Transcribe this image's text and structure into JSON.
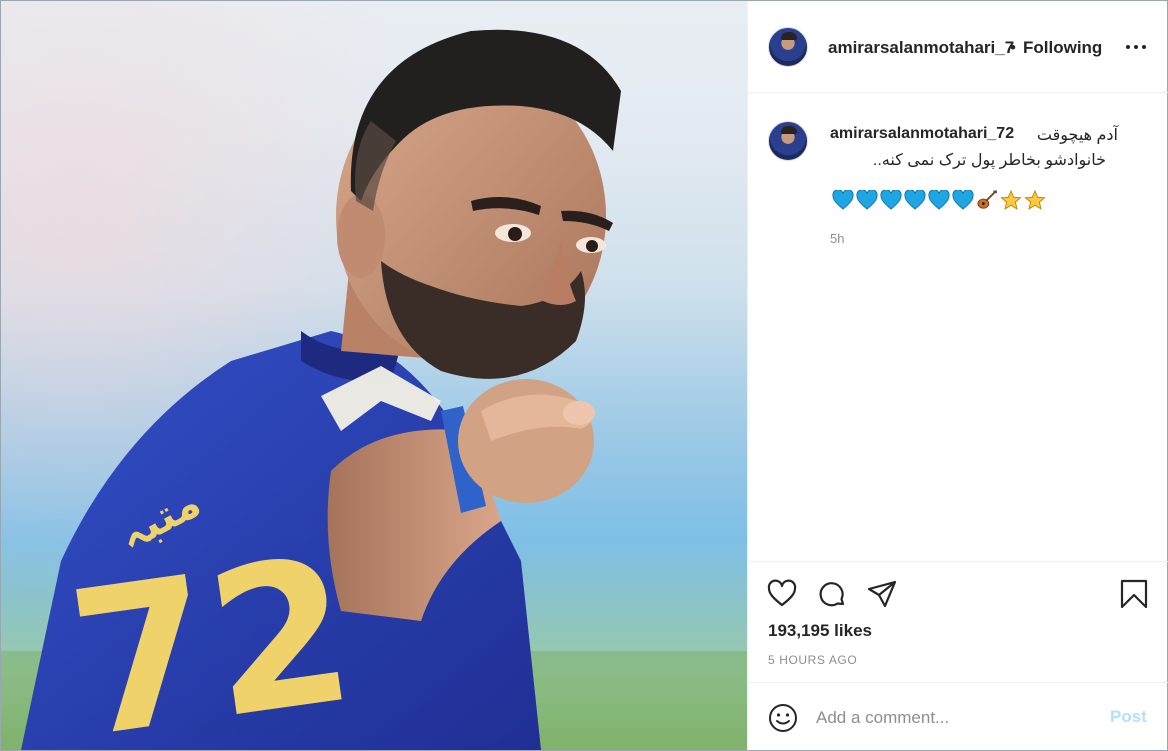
{
  "post": {
    "username": "amirarsalanmotahari_7",
    "separator": "•",
    "follow_status": "Following",
    "image_alt": "player-photo"
  },
  "caption": {
    "username": "amirarsalanmotahari_72",
    "text_line1": "آدم هیچوقت",
    "text_line2": "خانوادشو بخاطر پول ترک نمی کنه..",
    "emojis": [
      "blue-heart",
      "blue-heart",
      "blue-heart",
      "blue-heart",
      "blue-heart",
      "blue-heart",
      "guitar",
      "star",
      "star"
    ],
    "time": "5h"
  },
  "actions": {
    "likes": "193,195 likes",
    "posted": "5 HOURS AGO"
  },
  "comment_box": {
    "placeholder": "Add a comment...",
    "post_label": "Post"
  },
  "colors": {
    "jersey": "#2b3fb5",
    "number": "#f0d26a",
    "text": "#262626",
    "muted": "#8e8e8e",
    "post_disabled": "#b2dffc"
  }
}
